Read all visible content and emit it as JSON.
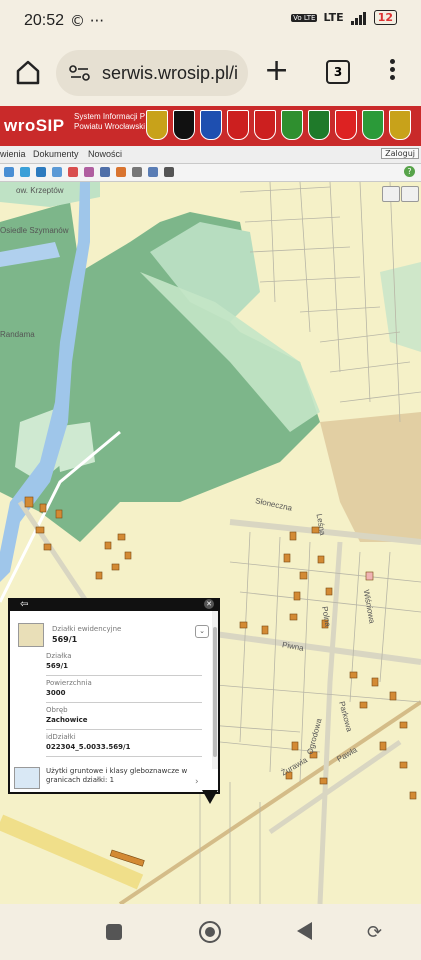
{
  "status": {
    "time": "20:52",
    "left_icons": "© ···",
    "network": "LTE",
    "volte": "Vo LTE",
    "battery": "12"
  },
  "browser": {
    "url": "serwis.wrosip.pl/i",
    "tab_count": "3"
  },
  "header": {
    "logo": "wroSIP",
    "subtitle_line1": "System Informacji P",
    "subtitle_line2": "Powiatu Wrocławski",
    "crest_colors": [
      "#c8a21a",
      "#111111",
      "#1e4fb0",
      "#cc1f1f",
      "#cc1f1f",
      "#2f8f2f",
      "#1f7a2a",
      "#dd2222",
      "#2b9a39",
      "#c8a21a"
    ]
  },
  "menu": {
    "items": [
      "wienia",
      "Dokumenty",
      "Nowości"
    ],
    "login": "Zaloguj"
  },
  "map": {
    "labels": {
      "krzeptow": "ow. Krzeptów",
      "szymanow": "Osiedle Szymanów",
      "randama": "Randama",
      "sloneczna": "Słoneczna",
      "polna": "Polna",
      "lesna": "Leśna",
      "wisniowa": "Wiśniowa",
      "piwna": "Piwna",
      "pawla": "Pawła",
      "parkowa": "Parkowa",
      "zurawia": "Żurawia",
      "ogrodowa": "Ogrodowa"
    }
  },
  "popup": {
    "title_label": "Działki ewidencyjne",
    "title_value": "569/1",
    "fields": [
      {
        "label": "Działka",
        "value": "569/1"
      },
      {
        "label": "Powierzchnia",
        "value": "3000"
      },
      {
        "label": "Obręb",
        "value": "Zachowice"
      },
      {
        "label": "idDziałki",
        "value": "022304_5.0033.569/1"
      }
    ],
    "land_text": "Użytki gruntowe i klasy gleboznawcze w granicach działki: 1"
  }
}
